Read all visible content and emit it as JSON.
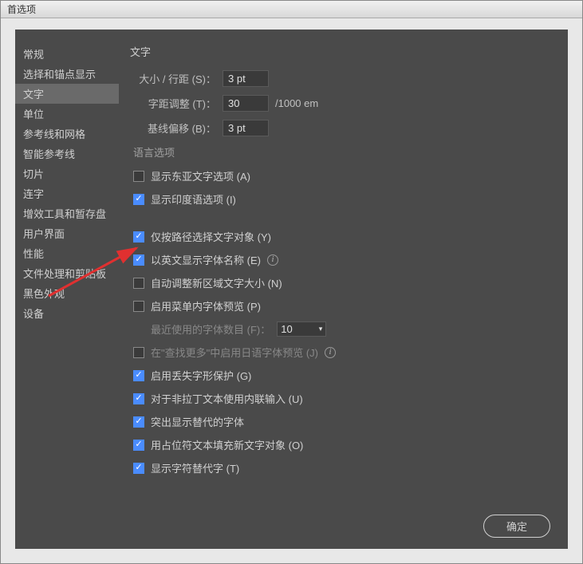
{
  "window": {
    "title": "首选项"
  },
  "sidebar": {
    "items": [
      {
        "label": "常规"
      },
      {
        "label": "选择和锚点显示"
      },
      {
        "label": "文字",
        "selected": true
      },
      {
        "label": "单位"
      },
      {
        "label": "参考线和网格"
      },
      {
        "label": "智能参考线"
      },
      {
        "label": "切片"
      },
      {
        "label": "连字"
      },
      {
        "label": "增效工具和暂存盘"
      },
      {
        "label": "用户界面"
      },
      {
        "label": "性能"
      },
      {
        "label": "文件处理和剪贴板"
      },
      {
        "label": "黑色外观"
      },
      {
        "label": "设备"
      }
    ]
  },
  "content": {
    "heading": "文字",
    "fields": {
      "size_leading": {
        "label": "大小 / 行距 (S)：",
        "value": "3 pt"
      },
      "tracking": {
        "label": "字距调整 (T)：",
        "value": "30",
        "unit": "/1000 em"
      },
      "baseline": {
        "label": "基线偏移 (B)：",
        "value": "3 pt"
      }
    },
    "lang_group": "语言选项",
    "checks": {
      "east_asian": {
        "label": "显示东亚文字选项 (A)",
        "checked": false
      },
      "indic": {
        "label": "显示印度语选项 (I)",
        "checked": true
      },
      "path_only": {
        "label": "仅按路径选择文字对象 (Y)",
        "checked": true
      },
      "english_font": {
        "label": "以英文显示字体名称 (E)",
        "checked": true,
        "info": true
      },
      "auto_size": {
        "label": "自动调整新区域文字大小 (N)",
        "checked": false
      },
      "menu_preview": {
        "label": "启用菜单内字体预览 (P)",
        "checked": false
      },
      "jp_preview": {
        "label": "在\"查找更多\"中启用日语字体预览 (J)",
        "checked": false,
        "info": true,
        "disabled": true
      },
      "missing_glyph": {
        "label": "启用丢失字形保护 (G)",
        "checked": true
      },
      "inline_input": {
        "label": "对于非拉丁文本使用内联输入 (U)",
        "checked": true
      },
      "highlight_sub": {
        "label": "突出显示替代的字体",
        "checked": true
      },
      "placeholder_text": {
        "label": "用占位符文本填充新文字对象 (O)",
        "checked": true
      },
      "show_alt_glyph": {
        "label": "显示字符替代字 (T)",
        "checked": true
      }
    },
    "recent_fonts": {
      "label": "最近使用的字体数目 (F)：",
      "value": "10"
    }
  },
  "buttons": {
    "ok": "确定"
  }
}
